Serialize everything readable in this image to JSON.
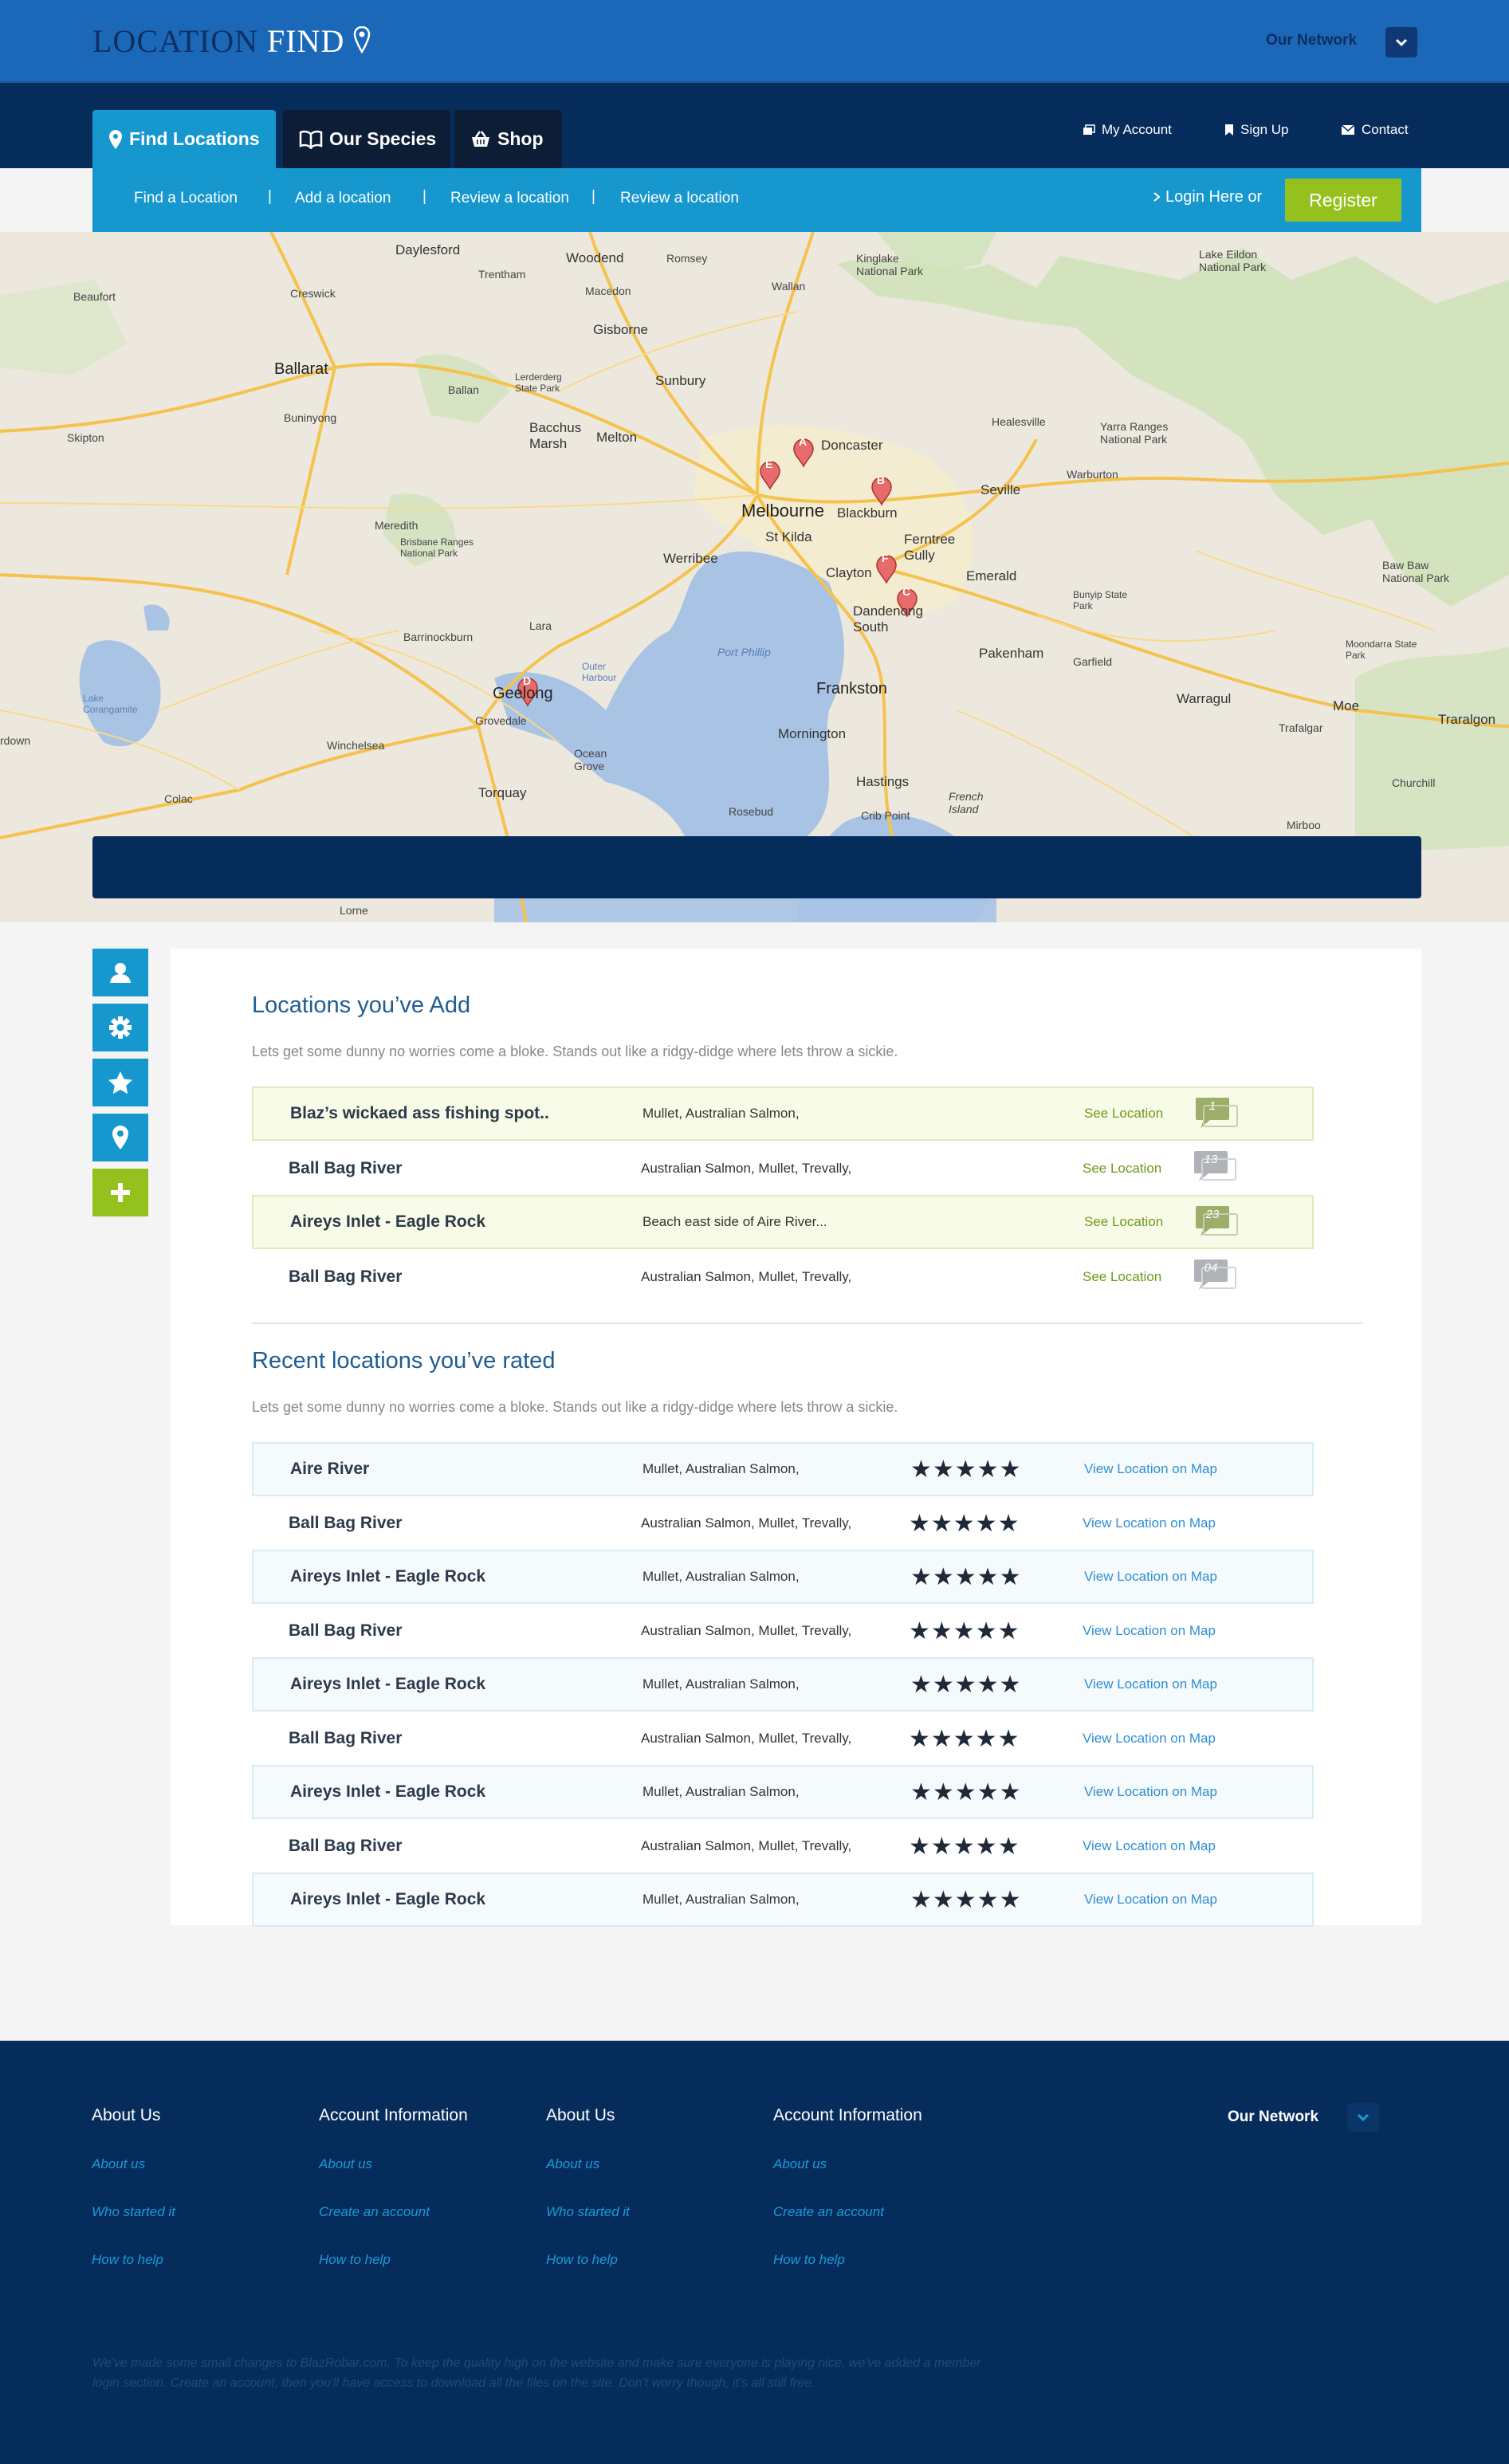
{
  "brand": {
    "logo_part1": "LOCATION ",
    "logo_part2": "FIND"
  },
  "header": {
    "network_label": "Our Network"
  },
  "nav": {
    "tabs": [
      {
        "label": "Find Locations",
        "icon": "map-pin-icon"
      },
      {
        "label": "Our Species",
        "icon": "book-icon"
      },
      {
        "label": "Shop",
        "icon": "basket-icon"
      }
    ],
    "links": [
      {
        "label": "My Account",
        "icon": "account-icon"
      },
      {
        "label": "Sign Up",
        "icon": "bookmark-icon"
      },
      {
        "label": "Contact",
        "icon": "mail-icon"
      }
    ]
  },
  "subnav": {
    "links": [
      "Find a Location",
      "Add a location",
      "Review a location",
      "Review a location"
    ],
    "separator": "|",
    "login_label": "Login Here or",
    "register_label": "Register"
  },
  "map": {
    "labels": [
      "Daylesford",
      "Woodend",
      "Romsey",
      "Kinglake National Park",
      "Lake Eildon National Park",
      "Beaufort",
      "Creswick",
      "Trentham",
      "Macedon",
      "Wallan",
      "Gisborne",
      "Ballarat",
      "Ballan",
      "Lerderderg State Park",
      "Sunbury",
      "Healesville",
      "Yarra Ranges National Park",
      "Skipton",
      "Buninyong",
      "Bacchus Marsh",
      "Melton",
      "Doncaster",
      "Warburton",
      "Melbourne",
      "Blackburn",
      "Seville",
      "Meredith",
      "Brisbane Ranges National Park",
      "St Kilda",
      "Ferntree Gully",
      "Werribee",
      "Clayton",
      "Emerald",
      "Baw Baw National Park",
      "Bunyip State Park",
      "Dandenong South",
      "Lara",
      "Barrinockburn",
      "Port Phillip",
      "Pakenham",
      "Garfield",
      "Moondarra State Park",
      "Geelong",
      "Outer Harbour",
      "Frankston",
      "Warragul",
      "Lake Corangamite",
      "Moe",
      "Traralgon",
      "Winchelsea",
      "Grovedale",
      "Mornington",
      "Trafalgar",
      "Ocean Grove",
      "Torquay",
      "Hastings",
      "Churchill",
      "Colac",
      "French Island",
      "Rosebud",
      "Crib Point",
      "Mirboo",
      "Lorne",
      "rdown"
    ],
    "markers": [
      "A",
      "B",
      "C",
      "D",
      "E",
      "F"
    ]
  },
  "side_icons": [
    "user-icon",
    "gear-icon",
    "star-icon",
    "location-icon",
    "plus-icon"
  ],
  "added": {
    "title": "Locations you’ve Add",
    "lead": "Lets get some dunny no worries come a bloke. Stands out like a ridgy-didge where lets throw a sickie.",
    "rows": [
      {
        "name": "Blaz’s wickaed ass fishing spot..",
        "desc": "Mullet, Australian Salmon,",
        "link": "See Location",
        "count": "1"
      },
      {
        "name": "Ball Bag River",
        "desc": "Australian Salmon, Mullet, Trevally,",
        "link": "See Location",
        "count": "13"
      },
      {
        "name": "Aireys Inlet - Eagle Rock",
        "desc": "Beach east side of Aire River...",
        "link": "See Location",
        "count": "23"
      },
      {
        "name": "Ball Bag River",
        "desc": "Australian Salmon, Mullet, Trevally,",
        "link": "See Location",
        "count": "04"
      }
    ]
  },
  "rated": {
    "title": "Recent locations you’ve rated",
    "lead": "Lets get some dunny no worries come a bloke. Stands out like a ridgy-didge where lets throw a sickie.",
    "stars": "★★★★★",
    "rows": [
      {
        "name": "Aire River",
        "desc": "Mullet, Australian Salmon,",
        "rating": 5,
        "link": "View Location on Map"
      },
      {
        "name": "Ball Bag River",
        "desc": "Australian Salmon, Mullet, Trevally,",
        "rating": 5,
        "link": "View Location on Map"
      },
      {
        "name": "Aireys Inlet - Eagle Rock",
        "desc": "Mullet, Australian Salmon,",
        "rating": 5,
        "link": "View Location on Map"
      },
      {
        "name": "Ball Bag River",
        "desc": "Australian Salmon, Mullet, Trevally,",
        "rating": 5,
        "link": "View Location on Map"
      },
      {
        "name": "Aireys Inlet - Eagle Rock",
        "desc": "Mullet, Australian Salmon,",
        "rating": 5,
        "link": "View Location on Map"
      },
      {
        "name": "Ball Bag River",
        "desc": "Australian Salmon, Mullet, Trevally,",
        "rating": 5,
        "link": "View Location on Map"
      },
      {
        "name": "Aireys Inlet - Eagle Rock",
        "desc": "Mullet, Australian Salmon,",
        "rating": 5,
        "link": "View Location on Map"
      },
      {
        "name": "Ball Bag River",
        "desc": "Australian Salmon, Mullet, Trevally,",
        "rating": 5,
        "link": "View Location on Map"
      },
      {
        "name": "Aireys Inlet - Eagle Rock",
        "desc": "Mullet, Australian Salmon,",
        "rating": 5,
        "link": "View Location on Map"
      }
    ]
  },
  "footer": {
    "columns": [
      {
        "title": "About Us",
        "links": [
          "About us",
          "Who started it",
          "How to help"
        ]
      },
      {
        "title": "Account Information",
        "links": [
          "About us",
          "Create an account",
          "How to help"
        ]
      },
      {
        "title": "About Us",
        "links": [
          "About us",
          "Who started it",
          "How to help"
        ]
      },
      {
        "title": "Account Information",
        "links": [
          "About us",
          "Create an account",
          "How to help"
        ]
      }
    ],
    "network_label": "Our Network",
    "note": "We've made some small changes to BlazRobar.com. To keep the quality high on the website and make sure everyone is playing nice, we've added a member login section. Create an account, then you'll have access to download all the files on the site. Don't worry though, it's all still free."
  },
  "colors": {
    "primary": "#1698cf",
    "navy": "#062c5c",
    "accent_green": "#95c11f",
    "header_blue": "#1c68b8"
  }
}
